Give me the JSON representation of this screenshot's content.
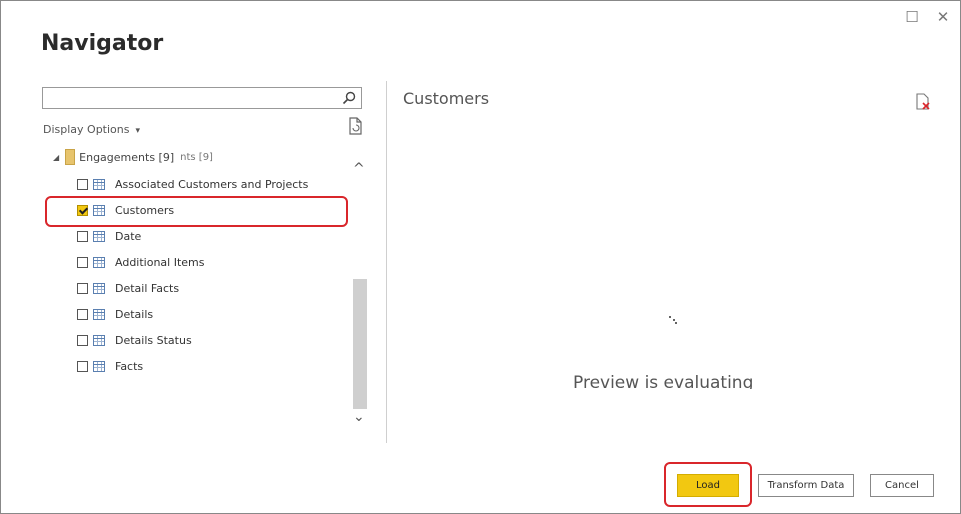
{
  "window": {
    "title": "Navigator",
    "maximize_glyph": "☐",
    "close_glyph": "✕"
  },
  "search": {
    "placeholder": "",
    "value": "",
    "icon": "search-icon"
  },
  "display_options": {
    "label": "Display Options",
    "caret": "▾"
  },
  "tree": {
    "folder": {
      "label": "Engagements [9]",
      "extra": "nts [9]",
      "expand_glyph": "◢"
    },
    "items": [
      {
        "label": "Associated Customers and Projects",
        "checked": false
      },
      {
        "label": "Customers",
        "checked": true
      },
      {
        "label": "Date",
        "checked": false
      },
      {
        "label": "Additional Items",
        "checked": false
      },
      {
        "label": "Detail Facts",
        "checked": false
      },
      {
        "label": "Details",
        "checked": false
      },
      {
        "label": "Details Status",
        "checked": false
      },
      {
        "label": "Facts",
        "checked": false
      }
    ]
  },
  "scrollbar": {
    "up_glyph": "^",
    "down_glyph": "⌄"
  },
  "preview": {
    "title": "Customers",
    "message": "Preview is evaluating"
  },
  "footer": {
    "load_label": "Load",
    "transform_label": "Transform Data",
    "cancel_label": "Cancel"
  },
  "colors": {
    "accent": "#f2c811",
    "highlight": "#d9262b"
  }
}
